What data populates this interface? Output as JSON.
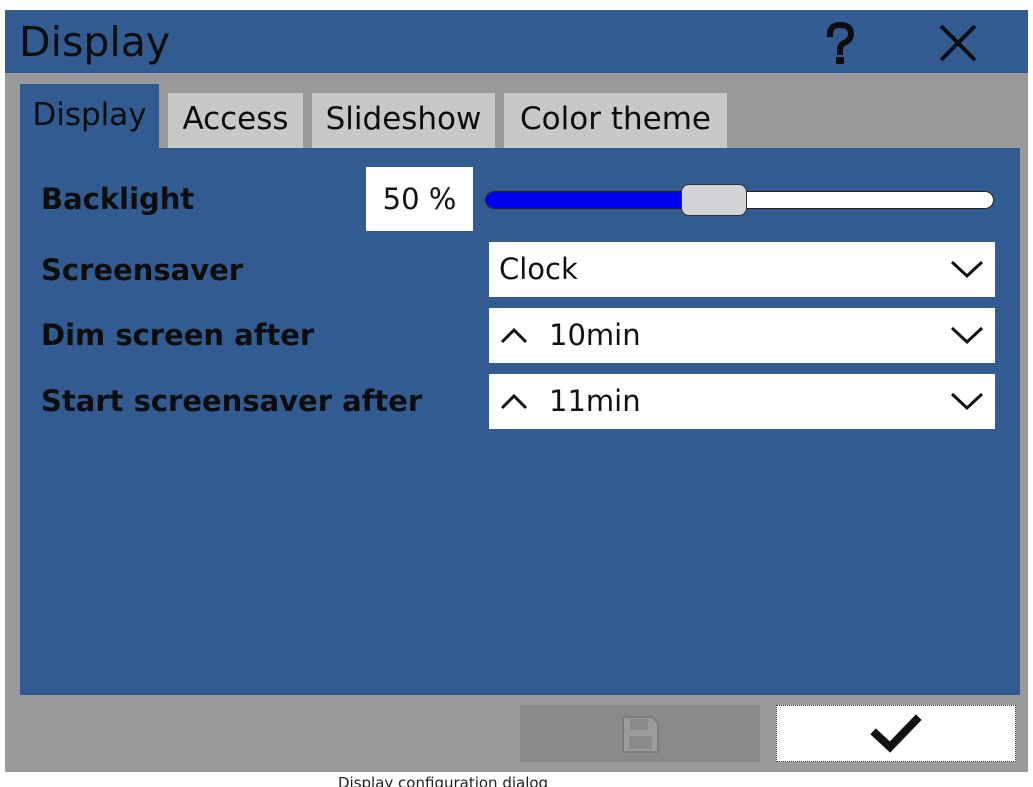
{
  "window": {
    "title": "Display",
    "help_icon": "question-mark-icon",
    "close_icon": "close-icon"
  },
  "tabs": [
    {
      "label": "Display",
      "active": true
    },
    {
      "label": "Access",
      "active": false
    },
    {
      "label": "Slideshow",
      "active": false
    },
    {
      "label": "Color theme",
      "active": false
    }
  ],
  "settings": {
    "backlight": {
      "label": "Backlight",
      "value_text": "50 %",
      "value": 0.5
    },
    "screensaver": {
      "label": "Screensaver",
      "value": "Clock"
    },
    "dim_screen": {
      "label": "Dim screen after",
      "value": "10min"
    },
    "start_screensaver": {
      "label": "Start screensaver after",
      "value": "11min"
    }
  },
  "footer": {
    "save_icon": "floppy-disk-icon",
    "ok_icon": "checkmark-icon"
  },
  "caption": "Display configuration dialog",
  "colors": {
    "panel": "#325b92",
    "window_bg": "#9a9a9a",
    "tab_inactive": "#c8c8c8",
    "slider_fill": "#0000ee",
    "save_disabled": "#8a8a8a"
  }
}
